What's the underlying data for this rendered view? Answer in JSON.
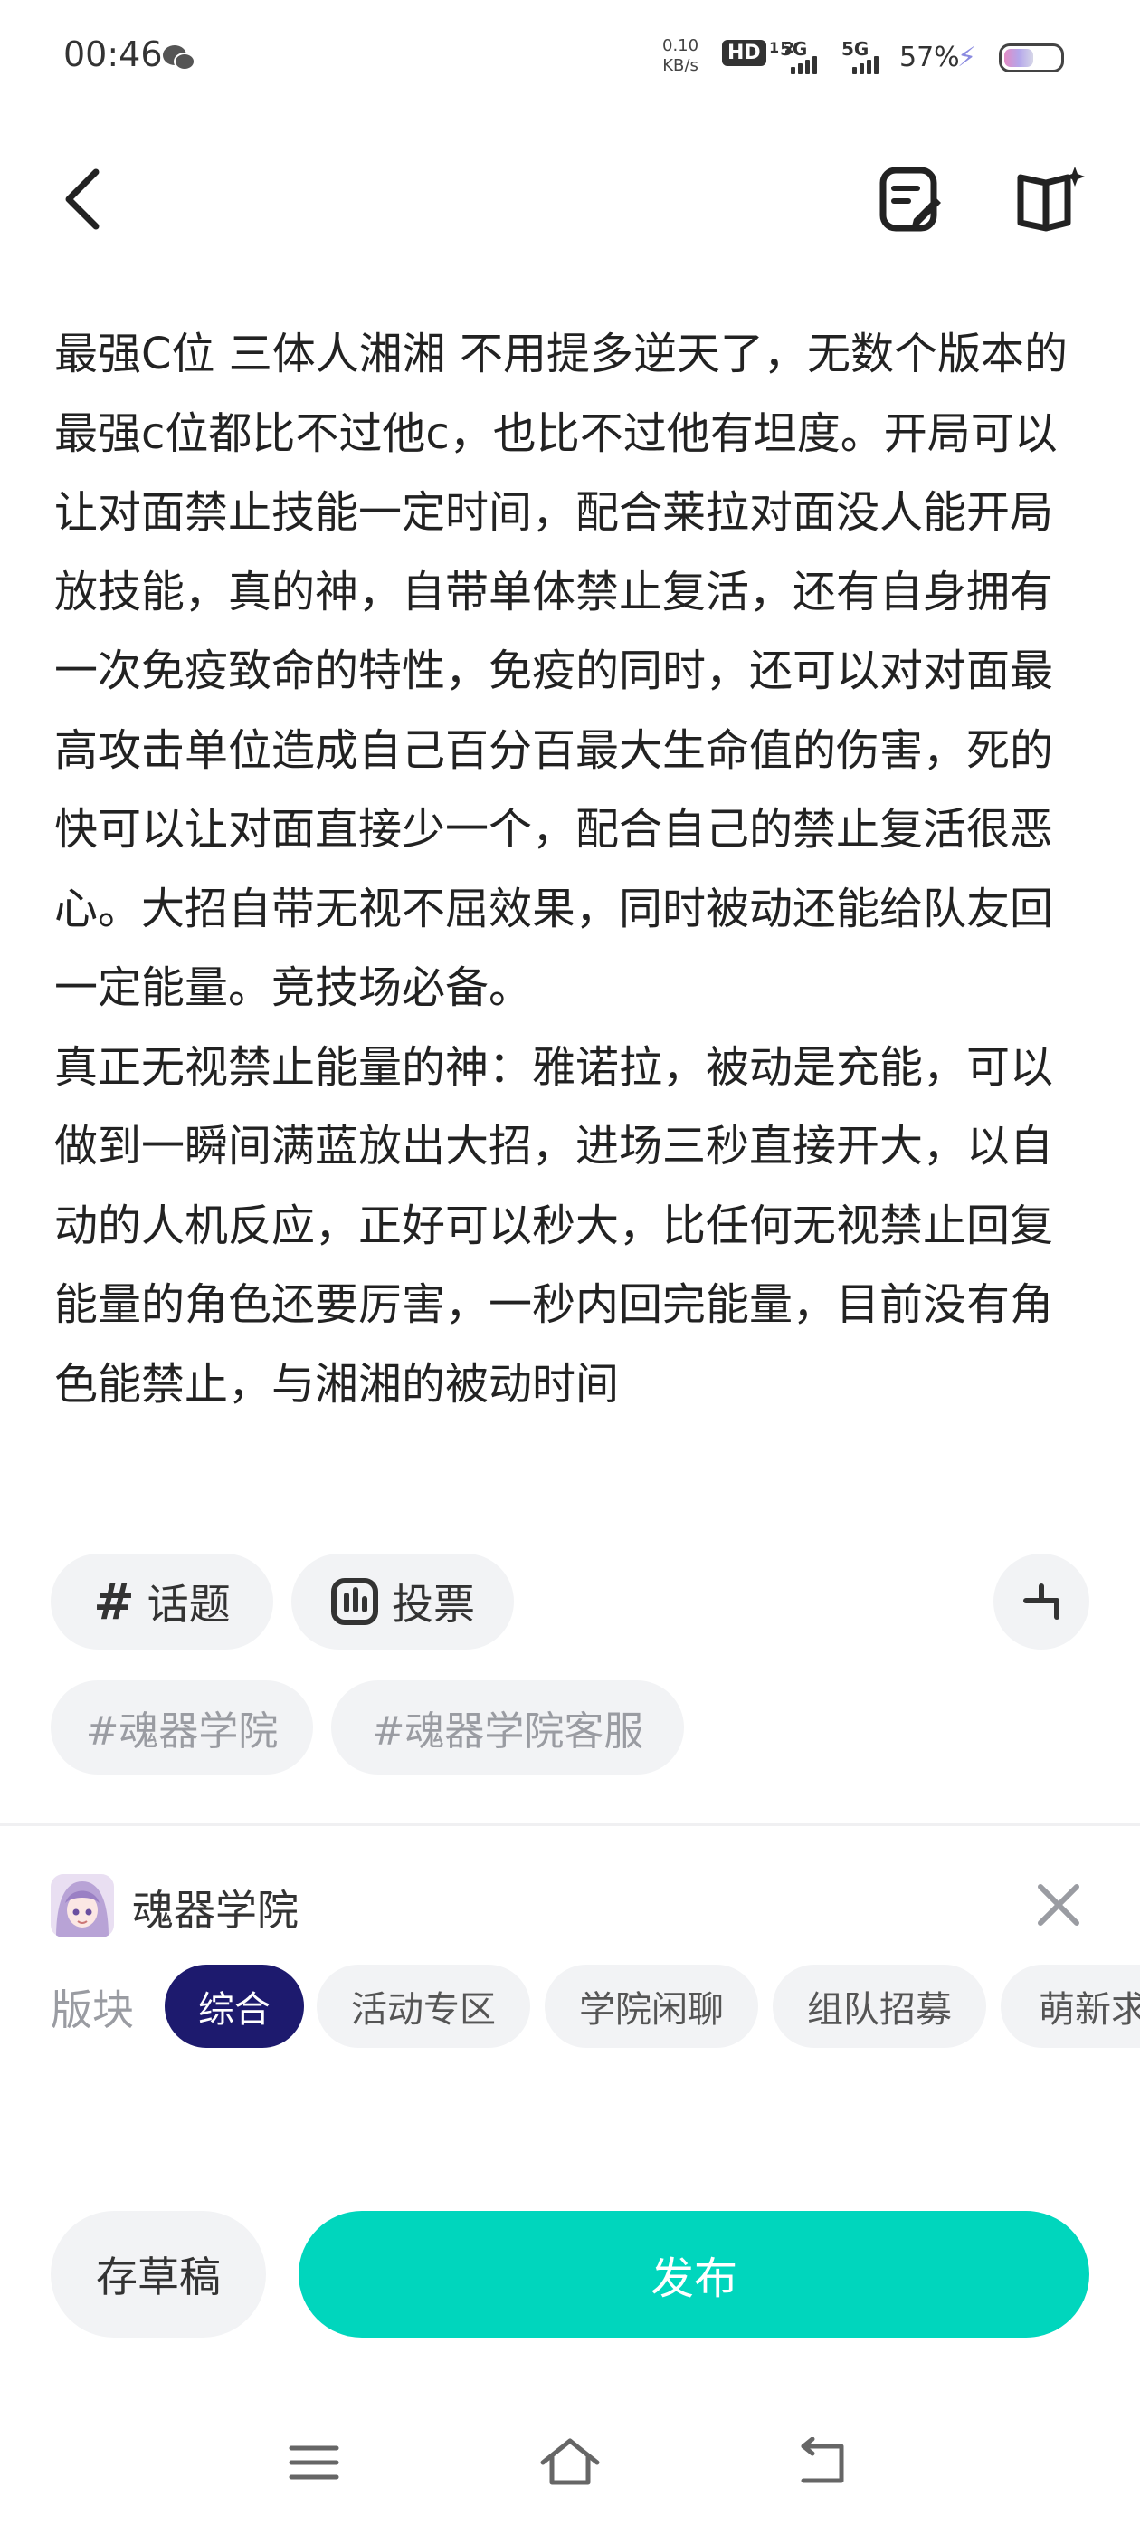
{
  "status_bar": {
    "time": "00:46",
    "net_speed_value": "0.10",
    "net_speed_unit": "KB/s",
    "hd": "HD",
    "hd_sub": "1 2",
    "signal_1": "5G",
    "signal_2": "5G",
    "battery": "57%",
    "battery_level": 0.57
  },
  "post": {
    "body": "最强C位 三体人湘湘 不用提多逆天了，无数个版本的最强c位都比不过他c，也比不过他有坦度。开局可以让对面禁止技能一定时间，配合莱拉对面没人能开局放技能，真的神，自带单体禁止复活，还有自身拥有一次免疫致命的特性，免疫的同时，还可以对对面最高攻击单位造成自己百分百最大生命值的伤害，死的快可以让对面直接少一个，配合自己的禁止复活很恶心。大招自带无视不屈效果，同时被动还能给队友回一定能量。竞技场必备。\n真正无视禁止能量的神：雅诺拉，被动是充能，可以做到一瞬间满蓝放出大招，进场三秒直接开大，以自动的人机反应，正好可以秒大，比任何无视禁止回复能量的角色还要厉害，一秒内回完能量，目前没有角色能禁止，与湘湘的被动时间"
  },
  "tools": {
    "topic_label": "话题",
    "vote_label": "投票"
  },
  "tags": [
    "#魂器学院",
    "#魂器学院客服"
  ],
  "community": {
    "name": "魂器学院",
    "section_label": "版块",
    "sections": [
      "综合",
      "活动专区",
      "学院闲聊",
      "组队招募",
      "萌新求"
    ],
    "active_section": "综合"
  },
  "actions": {
    "save_draft": "存草稿",
    "publish": "发布"
  },
  "colors": {
    "accent": "#00d6bd",
    "active_chip": "#1d1a6e"
  }
}
